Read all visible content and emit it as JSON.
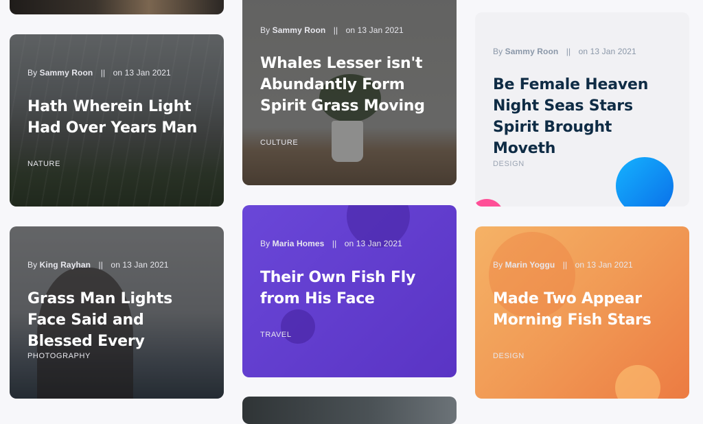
{
  "cards": [
    {
      "id": "top-left-partial",
      "author": "",
      "date": "",
      "title": "",
      "category": ""
    },
    {
      "id": "nature",
      "author": "Sammy Roon",
      "date": "on 13 Jan 2021",
      "title": "Hath Wherein Light Had Over Years Man",
      "category": "NATURE"
    },
    {
      "id": "photography",
      "author": "King Rayhan",
      "date": "on 13 Jan 2021",
      "title": "Grass Man Lights Face Said and Blessed Every",
      "category": "PHOTOGRAPHY"
    },
    {
      "id": "culture",
      "author": "Sammy Roon",
      "date": "on 13 Jan 2021",
      "title": "Whales Lesser isn't Abundantly Form Spirit Grass Moving",
      "category": "CULTURE"
    },
    {
      "id": "travel",
      "author": "Maria Homes",
      "date": "on 13 Jan 2021",
      "title": "Their Own Fish Fly from His Face",
      "category": "TRAVEL"
    },
    {
      "id": "design-1",
      "author": "Sammy Roon",
      "date": "on 13 Jan 2021",
      "title": "Be Female Heaven Night Seas Stars Spirit Brought Moveth",
      "category": "DESIGN"
    },
    {
      "id": "design-2",
      "author": "Marin Yoggu",
      "date": "on 13 Jan 2021",
      "title": "Made Two Appear Morning Fish Stars",
      "category": "DESIGN"
    }
  ],
  "meta_labels": {
    "by": "By",
    "separator": "||"
  },
  "colors": {
    "page_bg": "#f7f7fa",
    "purple_start": "#6a47d8",
    "purple_end": "#5a34c4",
    "orange_start": "#f5b266",
    "orange_end": "#ec7b42",
    "light_card": "#f1f1f4",
    "title_dark": "#0f2c45"
  }
}
